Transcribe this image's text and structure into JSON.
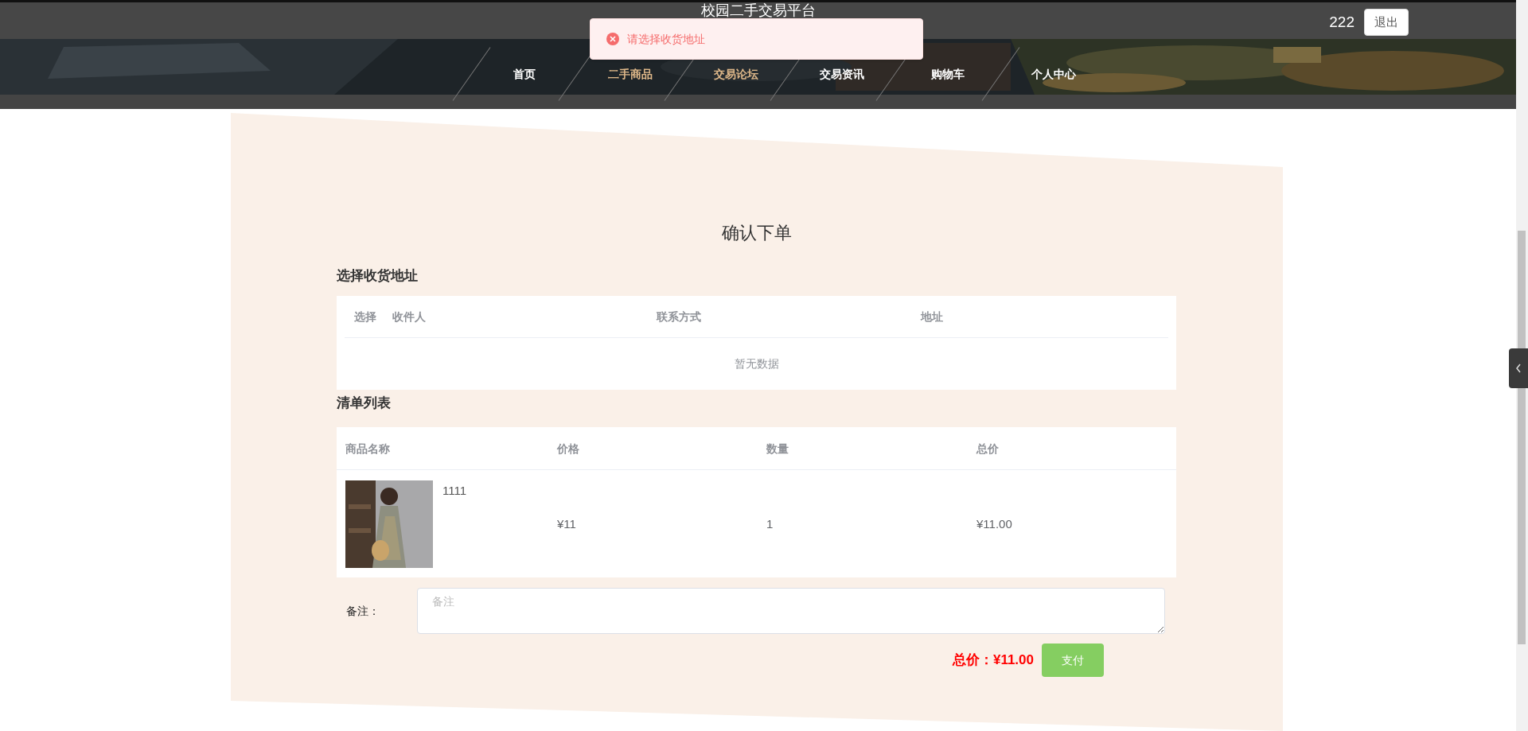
{
  "header": {
    "title": "校园二手交易平台",
    "username": "222",
    "logout_button": "退出"
  },
  "nav": [
    {
      "label": "首页",
      "highlighted": false
    },
    {
      "label": "二手商品",
      "highlighted": true
    },
    {
      "label": "交易论坛",
      "highlighted": true
    },
    {
      "label": "交易资讯",
      "highlighted": false
    },
    {
      "label": "购物车",
      "highlighted": false
    },
    {
      "label": "个人中心",
      "highlighted": false
    }
  ],
  "toast": {
    "kind": "error",
    "message": "请选择收货地址"
  },
  "page_title": "确认下单",
  "address_section": {
    "heading": "选择收货地址",
    "columns": [
      "选择",
      "收件人",
      "联系方式",
      "地址"
    ],
    "empty_text": "暂无数据"
  },
  "items_section": {
    "heading": "清单列表",
    "columns": [
      "商品名称",
      "价格",
      "数量",
      "总价"
    ],
    "rows": [
      {
        "name": "1111",
        "price": "¥11",
        "quantity": "1",
        "total": "¥11.00"
      }
    ]
  },
  "remark": {
    "label": "备注：",
    "placeholder": "备注"
  },
  "total": {
    "label": "总价：",
    "value": "¥11.00"
  },
  "pay_button": "支付"
}
